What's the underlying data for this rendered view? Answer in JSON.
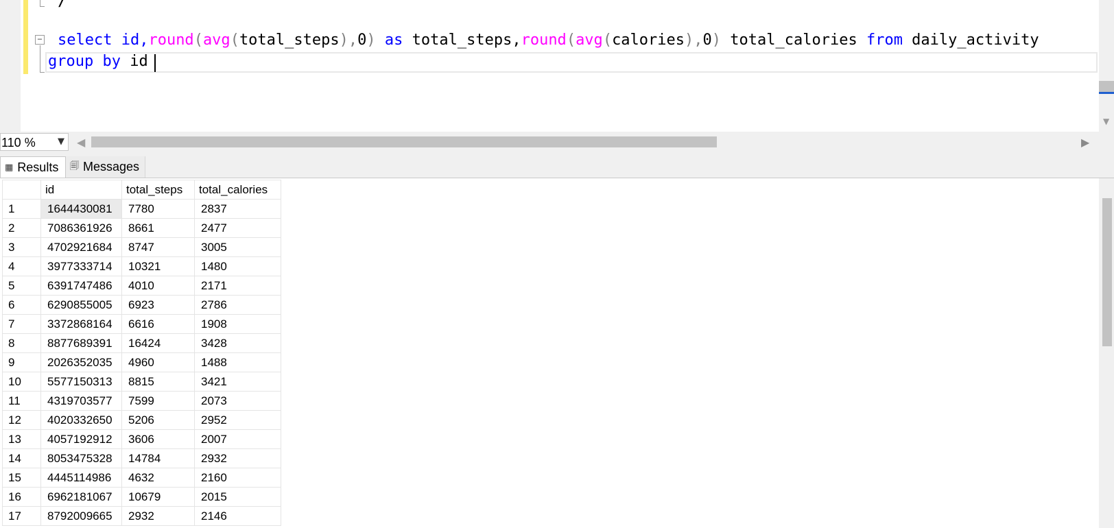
{
  "editor": {
    "prev_line_fragment": "/",
    "collapse_symbol": "−",
    "line1": {
      "t1": "select id,",
      "t2": "round",
      "t3": "(",
      "t4": "avg",
      "t5": "(",
      "t6": "total_steps",
      "t7": "),",
      "t8": "0",
      "t9": ")",
      "t10": " as",
      "t11": " total_steps,",
      "t12": "round",
      "t13": "(",
      "t14": "avg",
      "t15": "(",
      "t16": "calories",
      "t17": "),",
      "t18": "0",
      "t19": ")",
      "t20": " total_calories ",
      "t21": "from",
      "t22": " daily_activity"
    },
    "line2": {
      "kw": "group by",
      "rest": " id"
    }
  },
  "zoom": {
    "value": "110 %"
  },
  "tabs": {
    "results": "Results",
    "messages": "Messages"
  },
  "grid": {
    "columns": [
      "id",
      "total_steps",
      "total_calories"
    ],
    "rows": [
      {
        "n": "1",
        "id": "1644430081",
        "steps": "7780",
        "cal": "2837"
      },
      {
        "n": "2",
        "id": "7086361926",
        "steps": "8661",
        "cal": "2477"
      },
      {
        "n": "3",
        "id": "4702921684",
        "steps": "8747",
        "cal": "3005"
      },
      {
        "n": "4",
        "id": "3977333714",
        "steps": "10321",
        "cal": "1480"
      },
      {
        "n": "5",
        "id": "6391747486",
        "steps": "4010",
        "cal": "2171"
      },
      {
        "n": "6",
        "id": "6290855005",
        "steps": "6923",
        "cal": "2786"
      },
      {
        "n": "7",
        "id": "3372868164",
        "steps": "6616",
        "cal": "1908"
      },
      {
        "n": "8",
        "id": "8877689391",
        "steps": "16424",
        "cal": "3428"
      },
      {
        "n": "9",
        "id": "2026352035",
        "steps": "4960",
        "cal": "1488"
      },
      {
        "n": "10",
        "id": "5577150313",
        "steps": "8815",
        "cal": "3421"
      },
      {
        "n": "11",
        "id": "4319703577",
        "steps": "7599",
        "cal": "2073"
      },
      {
        "n": "12",
        "id": "4020332650",
        "steps": "5206",
        "cal": "2952"
      },
      {
        "n": "13",
        "id": "4057192912",
        "steps": "3606",
        "cal": "2007"
      },
      {
        "n": "14",
        "id": "8053475328",
        "steps": "14784",
        "cal": "2932"
      },
      {
        "n": "15",
        "id": "4445114986",
        "steps": "4632",
        "cal": "2160"
      },
      {
        "n": "16",
        "id": "6962181067",
        "steps": "10679",
        "cal": "2015"
      },
      {
        "n": "17",
        "id": "8792009665",
        "steps": "2932",
        "cal": "2146"
      }
    ]
  },
  "colors": {
    "keyword": "#0000ff",
    "function": "#ff00ff",
    "punctuation": "#808080",
    "change_bar": "#fbe96e"
  }
}
